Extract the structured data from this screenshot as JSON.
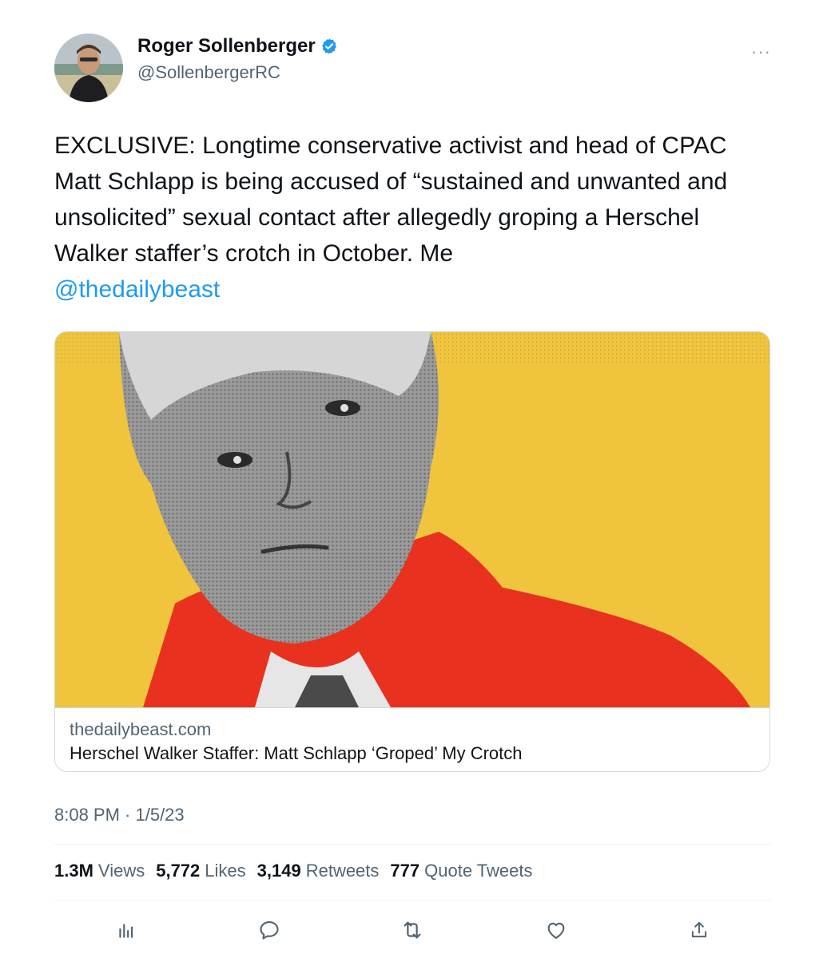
{
  "author": {
    "name": "Roger Sollenberger",
    "handle": "@SollenbergerRC",
    "verified_icon": "verified-badge-icon"
  },
  "menu": {
    "more_label": "···"
  },
  "tweet": {
    "text": "EXCLUSIVE: Longtime conservative activist and head of CPAC Matt Schlapp is being accused of “sustained and unwanted and unsolicited” sexual contact after allegedly groping a Herschel Walker staffer’s crotch in October. Me",
    "mention": "@thedailybeast",
    "timestamp": "8:08 PM · 1/5/23"
  },
  "link_card": {
    "domain": "thedailybeast.com",
    "title": "Herschel Walker Staffer: Matt Schlapp ‘Groped’ My Crotch"
  },
  "stats": [
    {
      "value": "1.3M",
      "label": "Views"
    },
    {
      "value": "5,772",
      "label": "Likes"
    },
    {
      "value": "3,149",
      "label": "Retweets"
    },
    {
      "value": "777",
      "label": "Quote Tweets"
    }
  ],
  "actions": [
    "analytics-icon",
    "reply-icon",
    "retweet-icon",
    "like-icon",
    "share-icon"
  ],
  "colors": {
    "accent": "#1d9bf0",
    "text": "#0f1419",
    "secondary": "#536471",
    "card_bg": "#f0c43d",
    "jacket": "#e8321f"
  }
}
